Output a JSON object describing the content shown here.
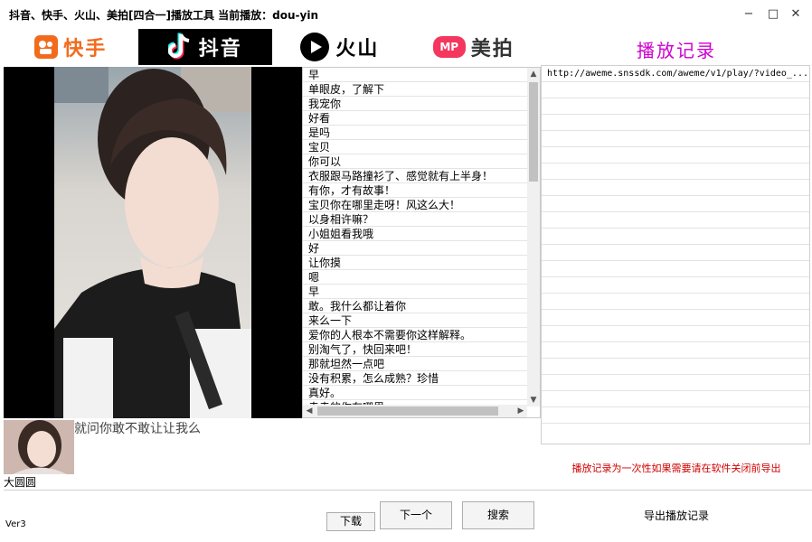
{
  "window": {
    "title": "抖音、快手、火山、美拍[四合一]播放工具   当前播放：dou-yin",
    "minimize": "−",
    "maximize": "□",
    "close": "✕"
  },
  "banner": {
    "kuaishou": "快手",
    "douyin": "抖音",
    "huoshan": "火山",
    "meipai": "美拍",
    "meipai_badge": "MP"
  },
  "comments": [
    "早",
    "单眼皮，了解下",
    "我宠你",
    "好看",
    "是吗",
    "宝贝",
    "你可以",
    "衣服跟马路撞衫了、感觉就有上半身！",
    "有你，才有故事！",
    "宝贝你在哪里走呀！风这么大！",
    "以身相许嘛？",
    "小姐姐看我哦",
    "好",
    "让你摸",
    "嗯",
    "早",
    "敢。我什么都让着你",
    "来么一下",
    "爱你的人根本不需要你这样解释。",
    "别淘气了，快回来吧！",
    "那就坦然一点吧",
    "没有积累，怎么成熟？珍惜",
    "真好。",
    "走走的你在哪里"
  ],
  "user": {
    "name": "大圆圆",
    "description": "就问你敢不敢让让我么"
  },
  "controls": {
    "version": "Ver3",
    "download": "下载",
    "next": "下一个",
    "search": "搜索"
  },
  "history": {
    "title": "播放记录",
    "entries": [
      "http://aweme.snssdk.com/aweme/v1/play/?video_..."
    ],
    "notice": "播放记录为一次性如果需要请在软件关闭前导出",
    "export": "导出播放记录"
  },
  "colors": {
    "kuaishou_orange": "#f26b1d",
    "history_title": "#d000d0",
    "notice_red": "#d00000"
  }
}
